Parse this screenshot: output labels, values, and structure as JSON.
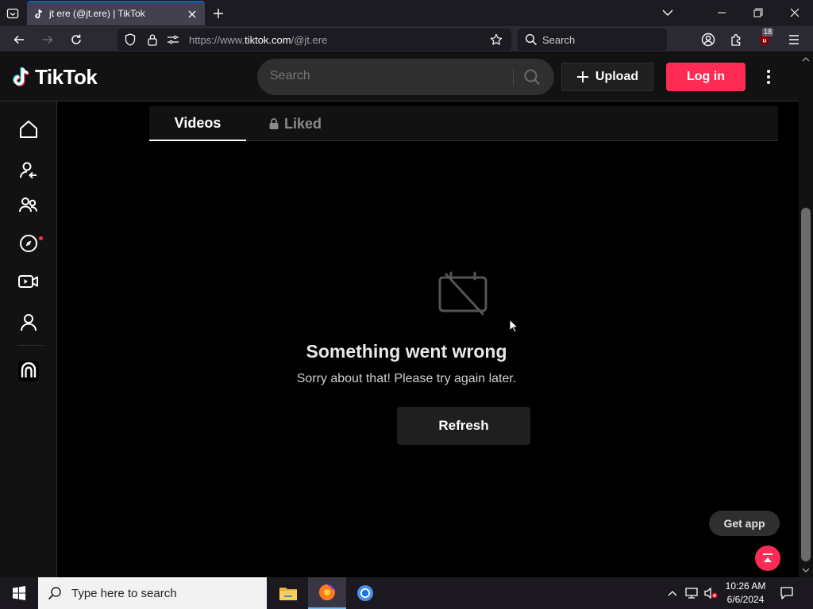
{
  "browser": {
    "tab": {
      "title": "jt ere (@jt.ere) | TikTok"
    },
    "url": {
      "prefix": "https://www.",
      "domain": "tiktok.com",
      "path": "/@jt.ere"
    },
    "search_placeholder": "Search",
    "extension_badge": "18"
  },
  "tiktok": {
    "logo_text": "TikTok",
    "search_placeholder": "Search",
    "upload_label": "Upload",
    "login_label": "Log in",
    "profile_tabs": {
      "videos": "Videos",
      "liked": "Liked"
    },
    "error": {
      "title": "Something went wrong",
      "subtitle": "Sorry about that! Please try again later.",
      "refresh_label": "Refresh"
    },
    "get_app_label": "Get app"
  },
  "taskbar": {
    "search_placeholder": "Type here to search",
    "time": "10:26 AM",
    "date": "6/6/2024"
  },
  "colors": {
    "accent": "#fe2c55",
    "browser_tab_active": "#42414d",
    "browser_toolbar": "#2b2a33",
    "tiktok_header": "#121212"
  }
}
